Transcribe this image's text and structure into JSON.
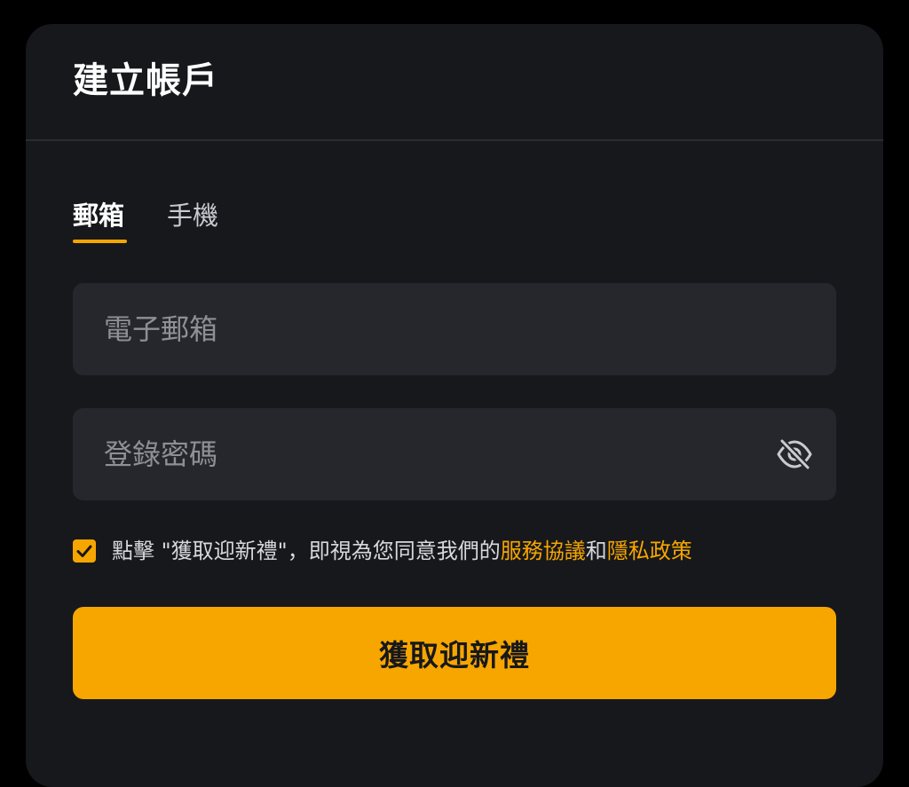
{
  "header": {
    "title": "建立帳戶"
  },
  "tabs": [
    {
      "label": "郵箱",
      "active": true
    },
    {
      "label": "手機",
      "active": false
    }
  ],
  "form": {
    "email": {
      "value": "",
      "placeholder": "電子郵箱"
    },
    "password": {
      "value": "",
      "placeholder": "登錄密碼",
      "toggle_icon": "eye-slash-icon"
    }
  },
  "agreement": {
    "checked": true,
    "text_prefix": "點擊 \"獲取迎新禮\"，即視為您同意我們的",
    "terms_link": "服務協議",
    "conjunction": "和",
    "privacy_link": "隱私政策"
  },
  "submit": {
    "label": "獲取迎新禮"
  },
  "colors": {
    "accent": "#f7a600",
    "card_bg": "#17181c",
    "input_bg": "#26272c",
    "page_bg": "#000000"
  }
}
